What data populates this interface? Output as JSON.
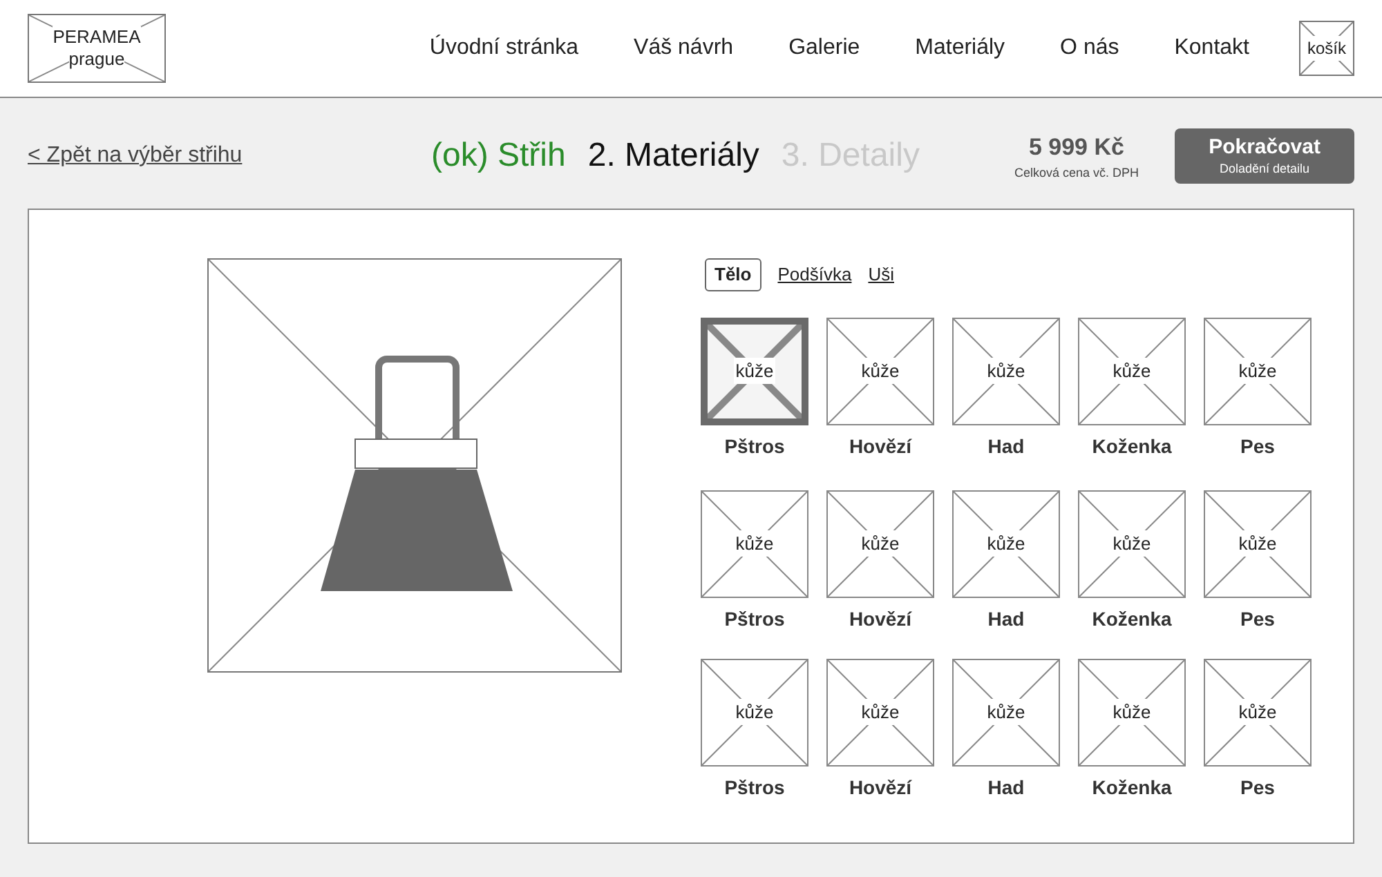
{
  "logo": {
    "name": "PERAMEA",
    "subtitle": "prague"
  },
  "nav": [
    "Úvodní stránka",
    "Váš návrh",
    "Galerie",
    "Materiály",
    "O nás",
    "Kontakt"
  ],
  "cart": {
    "label": "košík"
  },
  "back_link": "< Zpět na výběr střihu",
  "steps": [
    {
      "label": "(ok) Střih",
      "kind": "done"
    },
    {
      "label": "2. Materiály",
      "kind": "current"
    },
    {
      "label": "3. Detaily",
      "kind": "upcoming"
    }
  ],
  "price": {
    "amount": "5 999 Kč",
    "note": "Celková cena vč. DPH"
  },
  "continue_button": {
    "label": "Pokračovat",
    "sublabel": "Doladění detailu"
  },
  "material_tabs": [
    {
      "label": "Tělo",
      "selected": true
    },
    {
      "label": "Podšívka",
      "selected": false
    },
    {
      "label": "Uši",
      "selected": false
    }
  ],
  "materials": [
    {
      "image_label": "kůže",
      "name": "Pštros",
      "selected": true
    },
    {
      "image_label": "kůže",
      "name": "Hovězí",
      "selected": false
    },
    {
      "image_label": "kůže",
      "name": "Had",
      "selected": false
    },
    {
      "image_label": "kůže",
      "name": "Koženka",
      "selected": false
    },
    {
      "image_label": "kůže",
      "name": "Pes",
      "selected": false
    },
    {
      "image_label": "kůže",
      "name": "Pštros",
      "selected": false
    },
    {
      "image_label": "kůže",
      "name": "Hovězí",
      "selected": false
    },
    {
      "image_label": "kůže",
      "name": "Had",
      "selected": false
    },
    {
      "image_label": "kůže",
      "name": "Koženka",
      "selected": false
    },
    {
      "image_label": "kůže",
      "name": "Pes",
      "selected": false
    },
    {
      "image_label": "kůže",
      "name": "Pštros",
      "selected": false
    },
    {
      "image_label": "kůže",
      "name": "Hovězí",
      "selected": false
    },
    {
      "image_label": "kůže",
      "name": "Had",
      "selected": false
    },
    {
      "image_label": "kůže",
      "name": "Koženka",
      "selected": false
    },
    {
      "image_label": "kůže",
      "name": "Pes",
      "selected": false
    }
  ]
}
